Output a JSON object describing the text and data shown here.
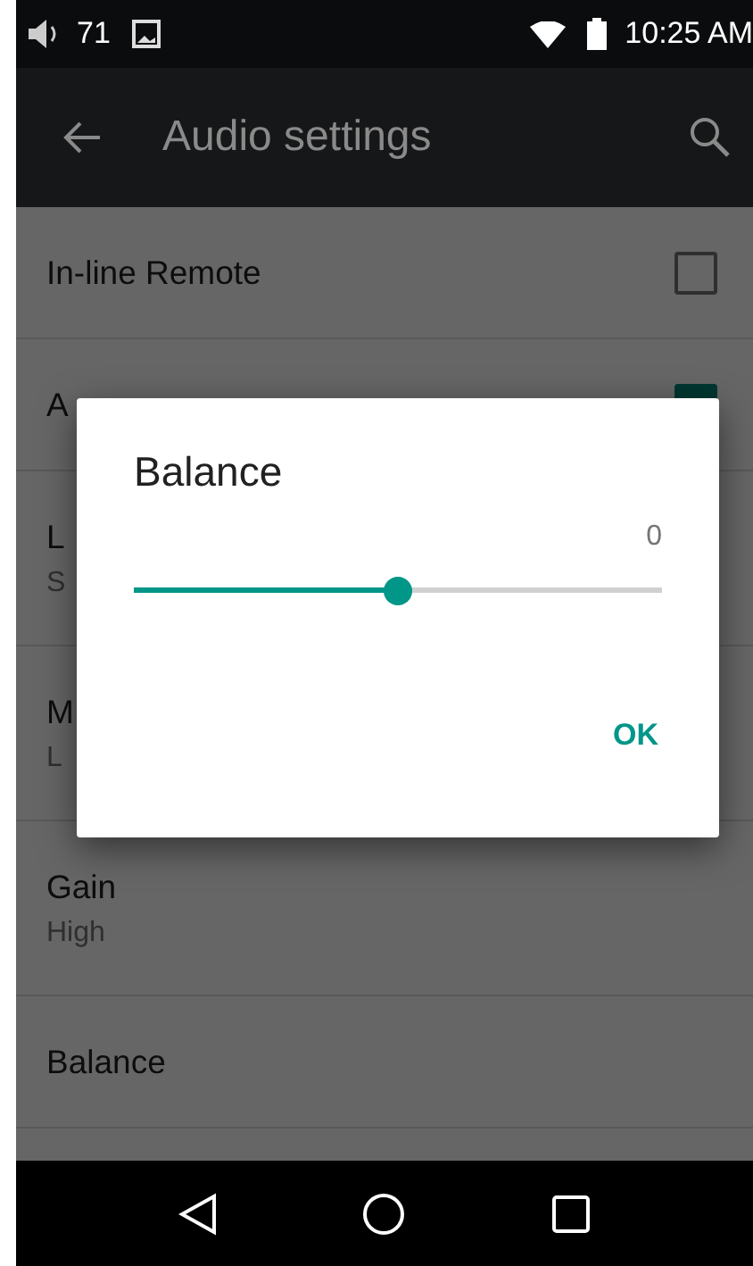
{
  "status_bar": {
    "volume": "71",
    "time": "10:25 AM"
  },
  "app_bar": {
    "title": "Audio settings"
  },
  "settings": [
    {
      "kind": "checkbox",
      "title": "In-line Remote",
      "checked": false
    },
    {
      "kind": "checkbox",
      "title": "A",
      "checked": true
    },
    {
      "kind": "text",
      "title": "L",
      "summary": "S"
    },
    {
      "kind": "text",
      "title": "M",
      "summary": "L"
    },
    {
      "kind": "text",
      "title": "Gain",
      "summary": "High"
    },
    {
      "kind": "plain",
      "title": "Balance"
    }
  ],
  "dialog": {
    "title": "Balance",
    "value": "0",
    "level": 0.5,
    "button": "OK"
  }
}
